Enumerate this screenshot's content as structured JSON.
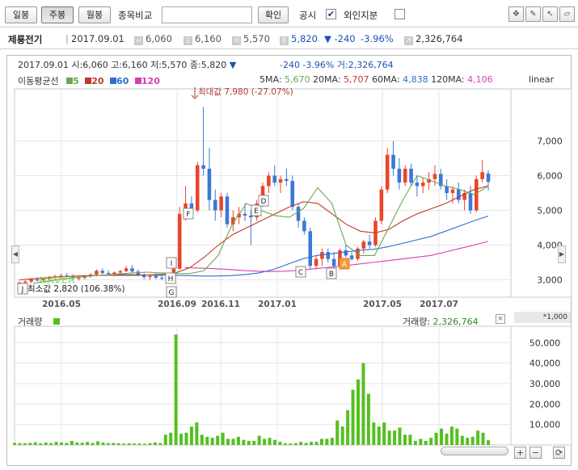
{
  "toolbar": {
    "daily": "일봉",
    "weekly": "주봉",
    "monthly": "월봉",
    "compare_label": "종목비교",
    "compare_value": "",
    "confirm": "확인",
    "disclosure": "공시",
    "disclosure_check": "✔",
    "foreign_ratio": "외인지분"
  },
  "info": {
    "name": "제룡전기",
    "date": "2017.09.01",
    "open_label": "시",
    "open": "6,060",
    "high_label": "고",
    "high": "6,160",
    "low_label": "저",
    "low": "5,570",
    "close_label": "종",
    "close": "5,820",
    "change": "▼ -240",
    "change_pct": "-3.96%",
    "volume_label": "거",
    "volume": "2,326,764"
  },
  "chart_header": {
    "summary": "2017.09.01 시:6,060 고:6,160 저:5,570 종:5,820",
    "arrow": "▼",
    "change": "-240  -3.96% 거:2,326,764",
    "ma_title": "이동평균선",
    "ma5": "5",
    "ma20": "20",
    "ma60": "60",
    "ma120": "120",
    "ma5_label": "5MA:",
    "ma5_val": "5,670",
    "ma20_label": "20MA:",
    "ma20_val": "5,707",
    "ma60_label": "60MA:",
    "ma60_val": "4,838",
    "ma120_label": "120MA:",
    "ma120_val": "4,106",
    "scale": "linear",
    "max_note": "최대값 7,980 (-27.07%)",
    "min_note": "최소값 2,820 (106.38%)",
    "volume_title": "거래량",
    "volume_label": "거래량:",
    "volume_val": "2,326,764",
    "volume_unit": "*1,000",
    "watermark": "NAVER"
  },
  "colors": {
    "up": "#e8462a",
    "down": "#3b78d8",
    "ma5": "#6aa84f",
    "ma20": "#c0392b",
    "ma60": "#2f6fcf",
    "ma120": "#d63fb3",
    "volume": "#55c020"
  },
  "chart_data": [
    {
      "type": "candlestick",
      "title": "",
      "x_tick_labels": [
        "2016.05",
        "2016.09",
        "2016.11",
        "2017.01",
        "2017.05",
        "2017.07"
      ],
      "y_tick_labels": [
        "3,000",
        "4,000",
        "5,000",
        "6,000",
        "7,000"
      ],
      "ylim": [
        2500,
        8500
      ],
      "markers": [
        "J",
        "I",
        "H",
        "G",
        "F",
        "E",
        "D",
        "C",
        "B",
        "A"
      ],
      "candles": [
        [
          2900,
          2960,
          2850,
          2920
        ],
        [
          2920,
          2990,
          2880,
          2950
        ],
        [
          2950,
          3050,
          2900,
          3010
        ],
        [
          3010,
          3080,
          2950,
          2990
        ],
        [
          2990,
          3060,
          2930,
          3030
        ],
        [
          3030,
          3110,
          2990,
          3070
        ],
        [
          3070,
          3150,
          3020,
          3100
        ],
        [
          3100,
          3180,
          3050,
          3120
        ],
        [
          3120,
          3200,
          3080,
          3090
        ],
        [
          3090,
          3160,
          3000,
          3040
        ],
        [
          3040,
          3100,
          2980,
          3060
        ],
        [
          3060,
          3140,
          3010,
          3110
        ],
        [
          3110,
          3190,
          3060,
          3150
        ],
        [
          3150,
          3300,
          3100,
          3260
        ],
        [
          3260,
          3330,
          3150,
          3200
        ],
        [
          3200,
          3280,
          3120,
          3170
        ],
        [
          3170,
          3240,
          3100,
          3210
        ],
        [
          3210,
          3290,
          3150,
          3250
        ],
        [
          3250,
          3400,
          3220,
          3330
        ],
        [
          3330,
          3420,
          3200,
          3240
        ],
        [
          3240,
          3300,
          3100,
          3140
        ],
        [
          3140,
          3200,
          3020,
          3080
        ],
        [
          3080,
          3150,
          3000,
          3110
        ],
        [
          3110,
          3180,
          3020,
          3060
        ],
        [
          3060,
          3120,
          2990,
          3040
        ],
        [
          3040,
          3100,
          2950,
          3000
        ],
        [
          3000,
          3350,
          2980,
          3320
        ],
        [
          3320,
          5100,
          3300,
          4900
        ],
        [
          4900,
          5700,
          4700,
          5200
        ],
        [
          5200,
          5400,
          4800,
          5000
        ],
        [
          5000,
          6400,
          4950,
          6300
        ],
        [
          6300,
          7980,
          6000,
          6200
        ],
        [
          6200,
          6800,
          5000,
          5300
        ],
        [
          5300,
          5600,
          4700,
          5000
        ],
        [
          5000,
          5500,
          4800,
          5400
        ],
        [
          5400,
          5500,
          4500,
          4600
        ],
        [
          4600,
          5000,
          4400,
          4800
        ],
        [
          4800,
          5100,
          4600,
          4900
        ],
        [
          4900,
          5200,
          4700,
          4850
        ],
        [
          4850,
          5000,
          4000,
          4800
        ],
        [
          4800,
          5300,
          4700,
          5200
        ],
        [
          5200,
          5800,
          5100,
          5700
        ],
        [
          5700,
          6100,
          5500,
          6000
        ],
        [
          6000,
          6300,
          5700,
          5800
        ],
        [
          5800,
          6000,
          5500,
          5900
        ],
        [
          5900,
          6200,
          5700,
          5850
        ],
        [
          5850,
          6000,
          5000,
          5100
        ],
        [
          5100,
          5200,
          4500,
          4700
        ],
        [
          4700,
          4800,
          4300,
          4400
        ],
        [
          4400,
          4500,
          3300,
          3400
        ],
        [
          3400,
          3700,
          3300,
          3600
        ],
        [
          3600,
          3900,
          3400,
          3800
        ],
        [
          3800,
          3900,
          3500,
          3600
        ],
        [
          3600,
          3800,
          3350,
          3400
        ],
        [
          3400,
          3900,
          3300,
          3850
        ],
        [
          3850,
          4000,
          3650,
          3700
        ],
        [
          3700,
          3800,
          3550,
          3600
        ],
        [
          3600,
          3950,
          3550,
          3900
        ],
        [
          3900,
          4150,
          3750,
          4100
        ],
        [
          4100,
          4300,
          3900,
          4000
        ],
        [
          4000,
          4800,
          3950,
          4700
        ],
        [
          4700,
          5700,
          4600,
          5600
        ],
        [
          5600,
          6800,
          5500,
          6600
        ],
        [
          6600,
          7000,
          6000,
          6200
        ],
        [
          6200,
          6500,
          5600,
          5800
        ],
        [
          5800,
          6300,
          5700,
          6200
        ],
        [
          6200,
          6350,
          5700,
          5800
        ],
        [
          5800,
          6000,
          5400,
          5700
        ],
        [
          5700,
          5950,
          5500,
          5800
        ],
        [
          5800,
          6100,
          5600,
          5900
        ],
        [
          5900,
          6300,
          5700,
          6050
        ],
        [
          6050,
          6200,
          5600,
          5700
        ],
        [
          5700,
          5900,
          5300,
          5500
        ],
        [
          5500,
          5700,
          5200,
          5600
        ],
        [
          5600,
          5800,
          5200,
          5300
        ],
        [
          5300,
          5600,
          5000,
          5500
        ],
        [
          5500,
          5700,
          4900,
          5000
        ],
        [
          5000,
          6000,
          4950,
          5900
        ],
        [
          5900,
          6450,
          5800,
          6100
        ],
        [
          6060,
          6160,
          5570,
          5820
        ]
      ],
      "ma_lines": {
        "ma5": [
          2900,
          2960,
          3020,
          3070,
          3110,
          3140,
          3170,
          3200,
          3220,
          3200,
          3180,
          3180,
          3260,
          3700,
          4600,
          5200,
          5000,
          4850,
          4800,
          5050,
          5650,
          5200,
          4000,
          3700,
          3700,
          4500,
          5300,
          6000,
          5850,
          5700,
          5600,
          5450,
          5700
        ],
        "ma20": [
          3000,
          3030,
          3060,
          3090,
          3110,
          3120,
          3130,
          3130,
          3130,
          3140,
          3160,
          3200,
          3350,
          3650,
          4000,
          4300,
          4500,
          4700,
          4900,
          5100,
          5250,
          5200,
          4900,
          4600,
          4400,
          4350,
          4450,
          4700,
          4900,
          5050,
          5200,
          5400,
          5600,
          5707
        ],
        "ma60": [
          3150,
          3150,
          3140,
          3130,
          3130,
          3120,
          3110,
          3110,
          3120,
          3150,
          3200,
          3300,
          3450,
          3600,
          3700,
          3750,
          3800,
          3850,
          3880,
          3950,
          4050,
          4150,
          4250,
          4400,
          4550,
          4700,
          4838
        ],
        "ma120": [
          3350,
          3340,
          3320,
          3300,
          3270,
          3250,
          3240,
          3250,
          3280,
          3320,
          3360,
          3400,
          3450,
          3500,
          3550,
          3600,
          3650,
          3700,
          3800,
          3900,
          4000,
          4106
        ]
      }
    },
    {
      "type": "bar",
      "title": "",
      "ylabel": "거래량",
      "y_tick_labels": [
        "10,000",
        "20,000",
        "30,000",
        "40,000",
        "50,000"
      ],
      "ylim": [
        0,
        58000
      ],
      "values": [
        1000,
        900,
        900,
        1000,
        1300,
        800,
        1200,
        900,
        1500,
        1200,
        1000,
        2000,
        1200,
        1100,
        1500,
        1000,
        1800,
        1200,
        900,
        1000,
        800,
        700,
        800,
        700,
        700,
        600,
        900,
        1200,
        900,
        5000,
        6000,
        54000,
        5500,
        6000,
        9000,
        11000,
        5000,
        4000,
        3500,
        4500,
        6000,
        3000,
        3000,
        4000,
        2500,
        2000,
        2000,
        4500,
        3000,
        3500,
        2500,
        1500,
        800,
        700,
        900,
        1500,
        1000,
        1500,
        1500,
        3000,
        3000,
        3500,
        12000,
        9000,
        17000,
        27000,
        32000,
        40000,
        25000,
        11000,
        9000,
        11000,
        7000,
        7000,
        8500,
        5000,
        5000,
        2000,
        3000,
        2000,
        3500,
        6000,
        8000,
        5500,
        9000,
        8000,
        4500,
        3500,
        4000,
        7000,
        6000,
        2326
      ]
    }
  ]
}
